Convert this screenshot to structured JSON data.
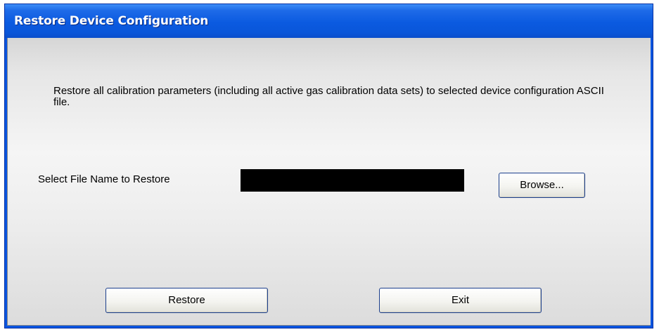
{
  "window": {
    "title": "Restore Device Configuration"
  },
  "dialog": {
    "description": "Restore all calibration parameters (including all active gas calibration data sets) to selected device configuration ASCII file.",
    "file_label": "Select File Name to Restore",
    "file_value": "",
    "browse_label": "Browse...",
    "restore_label": "Restore",
    "exit_label": "Exit"
  },
  "colors": {
    "titlebar": "#0a56d9",
    "title_text": "#ffffff",
    "file_field": "#000000"
  }
}
